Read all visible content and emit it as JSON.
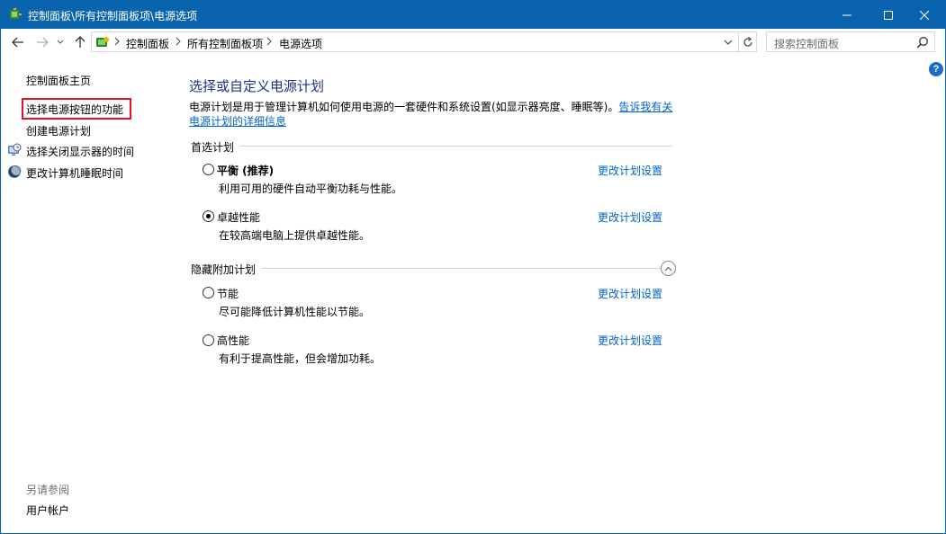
{
  "window": {
    "title": "控制面板\\所有控制面板项\\电源选项"
  },
  "address": {
    "crumbs": [
      "控制面板",
      "所有控制面板项",
      "电源选项"
    ],
    "search_placeholder": "搜索控制面板"
  },
  "sidebar": {
    "home": "控制面板主页",
    "items": [
      {
        "label": "选择电源按钮的功能",
        "highlighted": true
      },
      {
        "label": "创建电源计划"
      },
      {
        "label": "选择关闭显示器的时间",
        "icon": "clock-monitor-icon"
      },
      {
        "label": "更改计算机睡眠时间",
        "icon": "moon-icon"
      }
    ],
    "see_also_label": "另请参阅",
    "see_also_items": [
      "用户帐户"
    ]
  },
  "main": {
    "title": "选择或自定义电源计划",
    "description": "电源计划是用于管理计算机如何使用电源的一套硬件和系统设置(如显示器亮度、睡眠等)。",
    "description_link": "告诉我有关电源计划的详细信息",
    "preferred_group": "首选计划",
    "hidden_group": "隐藏附加计划",
    "plans": [
      {
        "name": "平衡 (推荐)",
        "desc": "利用可用的硬件自动平衡功耗与性能。",
        "link": "更改计划设置",
        "selected": false,
        "bold": true
      },
      {
        "name": "卓越性能",
        "desc": "在较高端电脑上提供卓越性能。",
        "link": "更改计划设置",
        "selected": true
      },
      {
        "name": "节能",
        "desc": "尽可能降低计算机性能以节能。",
        "link": "更改计划设置",
        "selected": false
      },
      {
        "name": "高性能",
        "desc": "有利于提高性能，但会增加功耗。",
        "link": "更改计划设置",
        "selected": false
      }
    ]
  },
  "colors": {
    "titlebar": "#0a64ad",
    "title_text": "#1e3287",
    "link": "#0066cc",
    "highlight": "#e81123"
  }
}
